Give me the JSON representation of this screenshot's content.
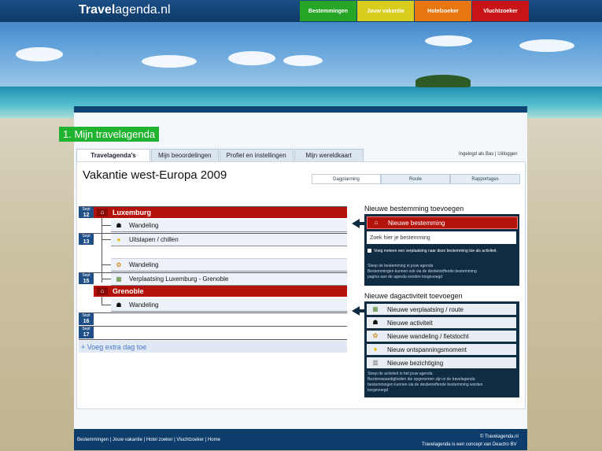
{
  "header": {
    "logo_bold": "Travel",
    "logo_thin": "agenda.nl",
    "nav": [
      {
        "label": "Bestemmingen",
        "color": "#27a527"
      },
      {
        "label": "Jouw vakantie",
        "color": "#d8cc1c"
      },
      {
        "label": "Hotelzoeker",
        "color": "#e77510"
      },
      {
        "label": "Vluchtzoeker",
        "color": "#c91417"
      }
    ]
  },
  "section_title": "1. Mijn travelagenda",
  "tabs": [
    "Travelagenda's",
    "Mijn beoordelingen",
    "Profiel en instellingen",
    "Mijn wereldkaart"
  ],
  "login_text": "Ingelogd als Bas | Uitloggen",
  "page_title": "Vakantie west-Europa 2009",
  "subtabs": [
    "Dagplanning",
    "Route",
    "Rapportages"
  ],
  "days": [
    {
      "month": "Sept",
      "day": "12"
    },
    {
      "month": "Sept",
      "day": "13"
    },
    {
      "month": "Sept",
      "day": "15"
    },
    {
      "month": "Sept",
      "day": "16"
    },
    {
      "month": "Sept",
      "day": "17"
    }
  ],
  "destinations": [
    "Luxemburg",
    "Grenoble"
  ],
  "activities": [
    "Wandeling",
    "Uitslapen / chillen",
    "Wandeling",
    "Verplaatsing Luxemburg - Grenoble",
    "Wandeling"
  ],
  "add_day": "+ Voeg extra dag toe",
  "new_destination": {
    "heading": "Nieuwe bestemming toevoegen",
    "button": "Nieuwe bestemming",
    "search_placeholder": "Zoek hier je bestemming",
    "checkbox_label": "Voeg meteen een verplaatsing naar deze bestemming toe als activiteit.",
    "help": [
      "Sleep de bestemming in jouw agenda",
      "Bestemmingen kunnen ook via de desbetreffende bestemming",
      "pagina aan de agenda worden toegevoegd"
    ]
  },
  "new_activity": {
    "heading": "Nieuwe dagactiviteit toevoegen",
    "buttons": [
      "Nieuwe verplaatsing / route",
      "Nieuwe activiteit",
      "Nieuwe wandeling / fietstocht",
      "Nieuw ontspanningsmoment",
      "Nieuwe bezichtiging"
    ],
    "help": [
      "Sleep de activiteit in het jouw agenda",
      "Bezienswaardigheden die opgenomen zijn in de travelagenda",
      "bestemmingen kunnen via de desbetreffende bestemming worden",
      "toegevoegd"
    ]
  },
  "footer": {
    "links": "Bestemmingen | Jouw vakantie | Hotel zoeker | Vluchtzoeker | Home",
    "copyright": "© Travelagenda.nl",
    "concept": "Travelagenda is een concept van Deactro BV"
  }
}
